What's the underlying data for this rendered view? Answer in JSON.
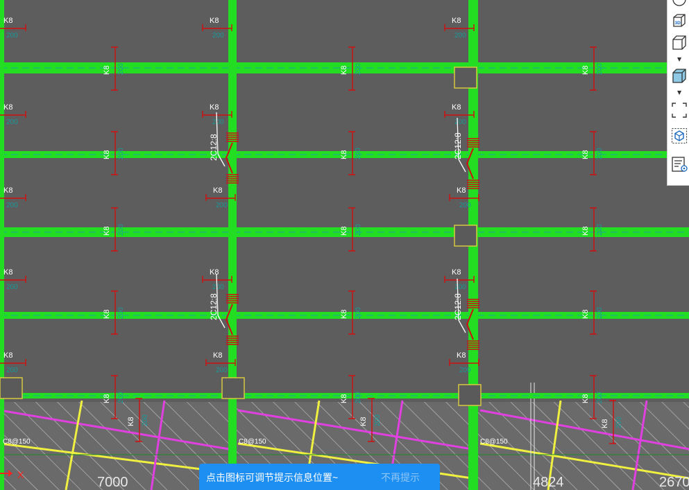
{
  "labels": {
    "stirrup": "K8",
    "slab_bottom_rebar": "C8@150",
    "beam_spacing": "200"
  },
  "beam_rebar_notes": [
    "2C12:8",
    "2C12:8",
    "2C12:8",
    "2C12:8"
  ],
  "dimensions": [
    "7000",
    "4824",
    "2670"
  ],
  "axis_label": "X",
  "hint_bar": {
    "message": "点击图标可调节提示信息位置~",
    "dismiss": "不再提示"
  },
  "toolbar_icons": [
    "view-cube-icon",
    "3d-view-icon",
    "box-view-icon",
    "dropdown-arrow-icon",
    "solid-box-icon",
    "dropdown-arrow-icon",
    "selection-frame-icon",
    "component-select-icon",
    "properties-list-icon"
  ],
  "colors": {
    "background": "#595959",
    "beam": "#22dd22",
    "rebar_red": "#d01010",
    "label_teal": "#1a9a9a",
    "magenta": "#e040e0",
    "yellow": "#f0f040",
    "hint_bg": "#1e8ff2"
  }
}
